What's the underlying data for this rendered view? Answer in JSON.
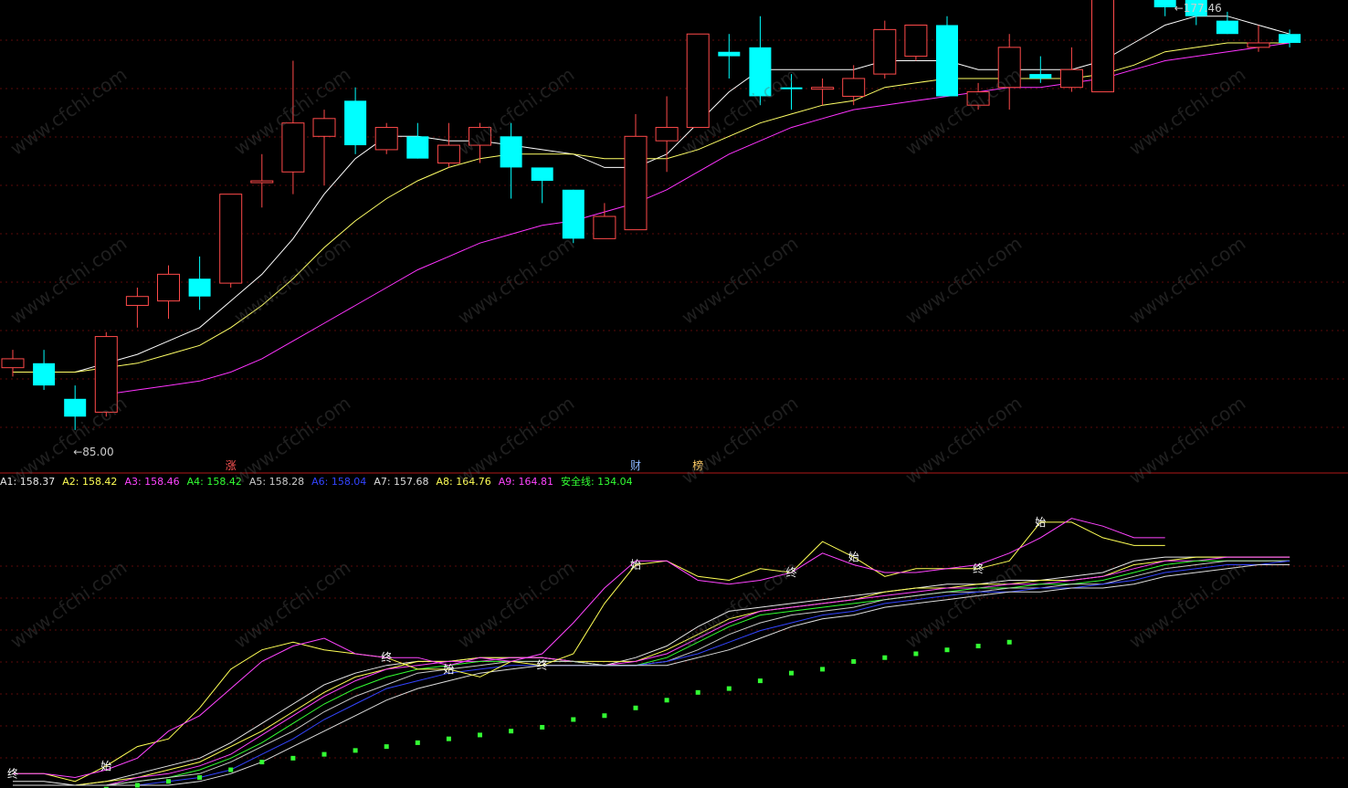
{
  "chart_data": [
    {
      "type": "candlestick",
      "title": "",
      "ylim": [
        80,
        182
      ],
      "max_label": "177.46",
      "min_label": "85.00",
      "candles": [
        {
          "o": 103,
          "c": 101,
          "h": 105,
          "l": 99,
          "up": true
        },
        {
          "o": 102,
          "c": 97,
          "h": 105,
          "l": 96,
          "up": false
        },
        {
          "o": 94,
          "c": 90,
          "h": 97,
          "l": 87,
          "up": false
        },
        {
          "o": 91,
          "c": 108,
          "h": 109,
          "l": 90,
          "up": true
        },
        {
          "o": 115,
          "c": 117,
          "h": 119,
          "l": 110,
          "up": true
        },
        {
          "o": 116,
          "c": 122,
          "h": 124,
          "l": 112,
          "up": true
        },
        {
          "o": 121,
          "c": 117,
          "h": 126,
          "l": 114,
          "up": false
        },
        {
          "o": 120,
          "c": 140,
          "h": 140,
          "l": 119,
          "up": true
        },
        {
          "o": 143,
          "c": 143,
          "h": 149,
          "l": 137,
          "up": true
        },
        {
          "o": 145,
          "c": 156,
          "h": 170,
          "l": 140,
          "up": true
        },
        {
          "o": 153,
          "c": 157,
          "h": 159,
          "l": 142,
          "up": true
        },
        {
          "o": 161,
          "c": 151,
          "h": 164,
          "l": 149,
          "up": false
        },
        {
          "o": 150,
          "c": 155,
          "h": 156,
          "l": 149,
          "up": true
        },
        {
          "o": 153,
          "c": 148,
          "h": 156,
          "l": 148,
          "up": false
        },
        {
          "o": 147,
          "c": 151,
          "h": 156,
          "l": 146,
          "up": true
        },
        {
          "o": 151,
          "c": 155,
          "h": 156,
          "l": 147,
          "up": true
        },
        {
          "o": 153,
          "c": 146,
          "h": 156,
          "l": 139,
          "up": false
        },
        {
          "o": 146,
          "c": 143,
          "h": 145,
          "l": 138,
          "up": false
        },
        {
          "o": 141,
          "c": 130,
          "h": 141,
          "l": 129,
          "up": false
        },
        {
          "o": 130,
          "c": 135,
          "h": 138,
          "l": 130,
          "up": true
        },
        {
          "o": 132,
          "c": 153,
          "h": 158,
          "l": 132,
          "up": true
        },
        {
          "o": 152,
          "c": 155,
          "h": 162,
          "l": 145,
          "up": true
        },
        {
          "o": 155,
          "c": 176,
          "h": 176,
          "l": 155,
          "up": true
        },
        {
          "o": 172,
          "c": 171,
          "h": 176,
          "l": 166,
          "up": false
        },
        {
          "o": 173,
          "c": 162,
          "h": 180,
          "l": 160,
          "up": false
        },
        {
          "o": 164,
          "c": 164,
          "h": 167,
          "l": 159,
          "up": false
        },
        {
          "o": 164,
          "c": 164,
          "h": 166,
          "l": 160,
          "up": true
        },
        {
          "o": 162,
          "c": 166,
          "h": 169,
          "l": 160,
          "up": true
        },
        {
          "o": 167,
          "c": 177,
          "h": 179,
          "l": 166,
          "up": true
        },
        {
          "o": 171,
          "c": 178,
          "h": 178,
          "l": 170,
          "up": true
        },
        {
          "o": 178,
          "c": 162,
          "h": 180,
          "l": 162,
          "up": false
        },
        {
          "o": 160,
          "c": 163,
          "h": 165,
          "l": 159,
          "up": true
        },
        {
          "o": 164,
          "c": 173,
          "h": 176,
          "l": 159,
          "up": true
        },
        {
          "o": 167,
          "c": 166,
          "h": 171,
          "l": 165,
          "up": false
        },
        {
          "o": 164,
          "c": 168,
          "h": 173,
          "l": 163,
          "up": true
        },
        {
          "o": 163,
          "c": 185,
          "h": 189,
          "l": 163,
          "up": true
        },
        {
          "o": 188,
          "c": 187,
          "h": 190,
          "l": 185,
          "up": false
        },
        {
          "o": 187,
          "c": 182,
          "h": 191,
          "l": 180,
          "up": false
        },
        {
          "o": 184,
          "c": 180,
          "h": 186,
          "l": 178,
          "up": false
        },
        {
          "o": 179,
          "c": 176,
          "h": 181,
          "l": 176,
          "up": false
        },
        {
          "o": 173,
          "c": 174,
          "h": 178,
          "l": 172,
          "up": true
        },
        {
          "o": 176,
          "c": 174,
          "h": 177,
          "l": 173,
          "up": false
        }
      ],
      "ma": [
        {
          "color": "#ffffff",
          "values": [
            null,
            null,
            100,
            102,
            104,
            107,
            110,
            116,
            122,
            130,
            140,
            148,
            153,
            153,
            152,
            152,
            151,
            150,
            149,
            146,
            146,
            149,
            156,
            163,
            168,
            168,
            168,
            168,
            170,
            170,
            170,
            168,
            168,
            168,
            168,
            170,
            174,
            178,
            180,
            180,
            178,
            176
          ]
        },
        {
          "color": "#ffff66",
          "values": [
            100,
            100,
            100,
            101,
            102,
            104,
            106,
            110,
            115,
            121,
            128,
            134,
            139,
            143,
            146,
            148,
            149,
            149,
            149,
            148,
            148,
            148,
            150,
            153,
            156,
            158,
            160,
            161,
            164,
            165,
            166,
            166,
            166,
            166,
            166,
            167,
            169,
            172,
            173,
            174,
            174,
            174
          ]
        },
        {
          "color": "#ff33ff",
          "values": [
            null,
            null,
            null,
            95,
            96,
            97,
            98,
            100,
            103,
            107,
            111,
            115,
            119,
            123,
            126,
            129,
            131,
            133,
            134,
            136,
            138,
            141,
            145,
            149,
            152,
            155,
            157,
            159,
            160,
            161,
            162,
            163,
            164,
            164,
            165,
            166,
            168,
            170,
            171,
            172,
            173,
            174
          ]
        }
      ],
      "markers": [
        {
          "index": 7,
          "text": "涨",
          "color": "#ff5555"
        },
        {
          "index": 20,
          "text": "财",
          "color": "#8ab4ff"
        },
        {
          "index": 22,
          "text": "榜",
          "color": "#ffcc66"
        }
      ]
    },
    {
      "type": "line",
      "title": "",
      "ylim": [
        100,
        172
      ],
      "legend": [
        {
          "label": "A1:",
          "value": "158.37",
          "color": "#e8e8e8"
        },
        {
          "label": "A2:",
          "value": "158.42",
          "color": "#ffff55"
        },
        {
          "label": "A3:",
          "value": "158.46",
          "color": "#ff44ff"
        },
        {
          "label": "A4:",
          "value": "158.42",
          "color": "#33ff33"
        },
        {
          "label": "A5:",
          "value": "158.28",
          "color": "#cccccc"
        },
        {
          "label": "A6:",
          "value": "158.04",
          "color": "#3344ff"
        },
        {
          "label": "A7:",
          "value": "157.68",
          "color": "#dddddd"
        },
        {
          "label": "A8:",
          "value": "164.76",
          "color": "#ffff55"
        },
        {
          "label": "A9:",
          "value": "164.81",
          "color": "#ff44ff"
        },
        {
          "label": "安全线:",
          "value": "134.04",
          "color": "#33ff33"
        }
      ],
      "series": [
        {
          "color": "#e8e8e8",
          "values": [
            101,
            101,
            100,
            101,
            103,
            105,
            107,
            111,
            116,
            121,
            126,
            129,
            131,
            132,
            132,
            133,
            133,
            133,
            132,
            131,
            133,
            136,
            141,
            145,
            146,
            147,
            148,
            149,
            150,
            151,
            152,
            152,
            153,
            153,
            154,
            155,
            158,
            159,
            159,
            159,
            159,
            159
          ]
        },
        {
          "color": "#ffff55",
          "values": [
            100,
            100,
            100,
            101,
            102,
            104,
            106,
            110,
            114,
            119,
            124,
            128,
            130,
            132,
            132,
            133,
            133,
            133,
            132,
            132,
            132,
            135,
            139,
            143,
            145,
            146,
            147,
            148,
            150,
            151,
            151,
            152,
            152,
            153,
            153,
            154,
            157,
            158,
            159,
            159,
            159,
            159
          ]
        },
        {
          "color": "#ff44ff",
          "values": [
            100,
            100,
            100,
            100,
            102,
            103,
            105,
            108,
            113,
            118,
            123,
            127,
            130,
            131,
            132,
            132,
            133,
            133,
            132,
            131,
            132,
            134,
            138,
            142,
            145,
            146,
            147,
            148,
            149,
            150,
            151,
            151,
            152,
            152,
            153,
            154,
            156,
            158,
            158,
            159,
            159,
            159
          ]
        },
        {
          "color": "#33ff33",
          "values": [
            100,
            100,
            100,
            100,
            101,
            102,
            104,
            107,
            111,
            116,
            121,
            125,
            128,
            130,
            131,
            132,
            132,
            132,
            132,
            131,
            131,
            133,
            137,
            141,
            144,
            145,
            146,
            147,
            148,
            149,
            150,
            151,
            151,
            152,
            152,
            153,
            155,
            157,
            158,
            158,
            158,
            158
          ]
        },
        {
          "color": "#cccccc",
          "values": [
            100,
            100,
            100,
            100,
            101,
            102,
            103,
            106,
            110,
            114,
            119,
            123,
            126,
            129,
            130,
            131,
            132,
            132,
            132,
            131,
            131,
            132,
            135,
            139,
            142,
            144,
            145,
            146,
            148,
            149,
            150,
            150,
            151,
            151,
            152,
            152,
            154,
            156,
            157,
            158,
            158,
            158
          ]
        },
        {
          "color": "#3344ff",
          "values": [
            100,
            100,
            100,
            100,
            100,
            101,
            102,
            104,
            108,
            112,
            117,
            121,
            125,
            127,
            129,
            130,
            131,
            131,
            131,
            131,
            131,
            132,
            134,
            137,
            140,
            142,
            144,
            145,
            147,
            148,
            149,
            150,
            150,
            151,
            151,
            152,
            153,
            155,
            156,
            157,
            157,
            158
          ]
        },
        {
          "color": "#dddddd",
          "values": [
            100,
            100,
            100,
            100,
            100,
            100,
            101,
            103,
            106,
            110,
            114,
            118,
            122,
            125,
            127,
            129,
            130,
            131,
            131,
            131,
            131,
            131,
            133,
            135,
            138,
            141,
            143,
            144,
            146,
            147,
            148,
            149,
            150,
            150,
            151,
            151,
            152,
            154,
            155,
            156,
            157,
            157
          ]
        },
        {
          "color": "#ffff55",
          "values": [
            103,
            103,
            101,
            105,
            110,
            112,
            120,
            130,
            135,
            137,
            135,
            134,
            133,
            130,
            130,
            128,
            132,
            131,
            134,
            147,
            157,
            158,
            154,
            153,
            156,
            155,
            163,
            159,
            154,
            156,
            156,
            156,
            158,
            168,
            168,
            164,
            162,
            162
          ]
        },
        {
          "color": "#ff44ff",
          "values": [
            103,
            103,
            102,
            104,
            107,
            114,
            118,
            125,
            132,
            136,
            138,
            134,
            133,
            133,
            131,
            133,
            132,
            134,
            142,
            151,
            158,
            158,
            153,
            152,
            153,
            155,
            160,
            157,
            155,
            155,
            156,
            157,
            160,
            164,
            169,
            167,
            164,
            164
          ]
        },
        {
          "color": "#33ff33",
          "type": "dots",
          "values": [
            96,
            97,
            98,
            99,
            100,
            101,
            102,
            104,
            106,
            107,
            108,
            109,
            110,
            111,
            112,
            113,
            114,
            115,
            117,
            118,
            120,
            122,
            124,
            125,
            127,
            129,
            130,
            132,
            133,
            134,
            135,
            136,
            137
          ]
        }
      ],
      "markers": [
        {
          "text": "终",
          "color": "#ffffff"
        },
        {
          "text": "始",
          "color": "#ffffff"
        },
        {
          "text": "终",
          "color": "#ffffff"
        },
        {
          "text": "始",
          "color": "#ffffff"
        },
        {
          "text": "终",
          "color": "#ffffff"
        },
        {
          "text": "始",
          "color": "#ffffff"
        },
        {
          "text": "终",
          "color": "#ffffff"
        },
        {
          "text": "始",
          "color": "#ffffff"
        },
        {
          "text": "终",
          "color": "#ffffff"
        },
        {
          "text": "始",
          "color": "#ffffff"
        }
      ]
    }
  ],
  "watermark_text": "www.cfchi.com"
}
